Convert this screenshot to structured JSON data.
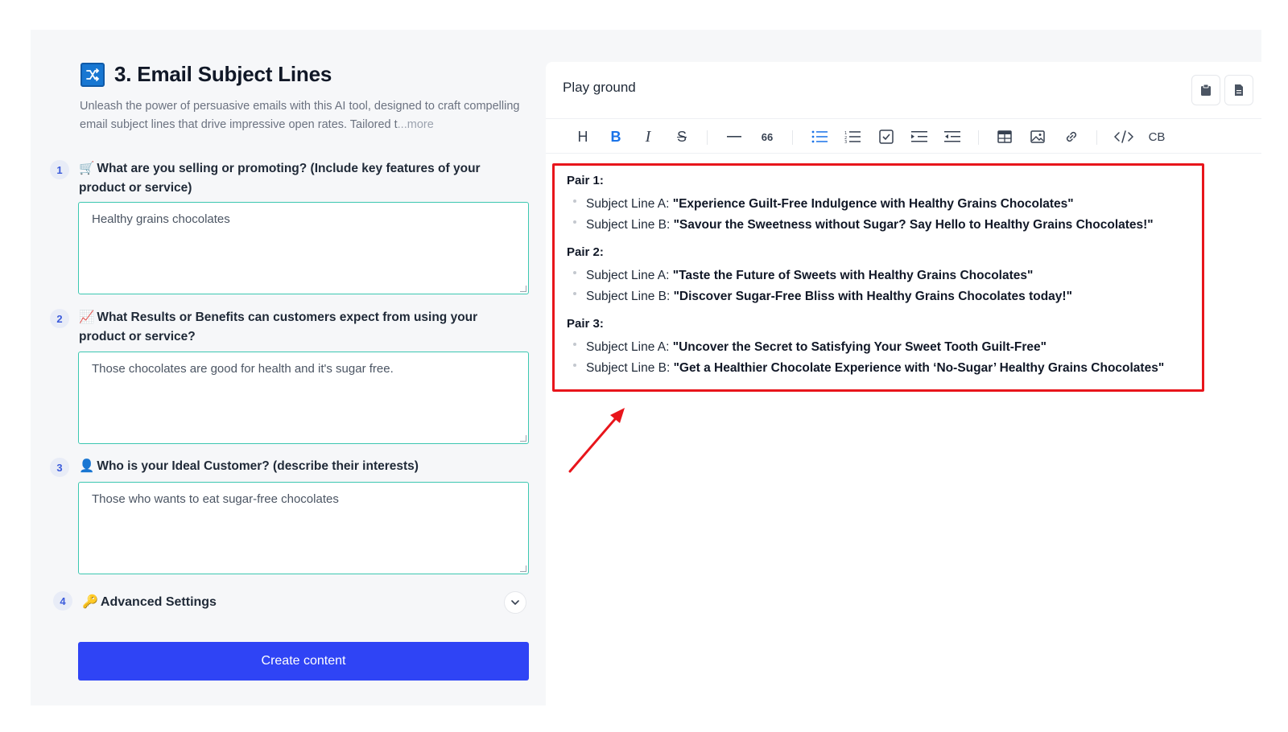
{
  "left": {
    "title": "3. Email Subject Lines",
    "description": "Unleash the power of persuasive emails with this AI tool, designed to craft compelling email subject lines that drive impressive open rates. Tailored t",
    "more_label": "...more",
    "questions": [
      {
        "number": "1",
        "emoji": "🛒",
        "label": "What are you selling or promoting? (Include key features of your product or service)",
        "value": "Healthy grains chocolates"
      },
      {
        "number": "2",
        "emoji": "📈",
        "label": "What Results or Benefits can customers expect from using your product or service?",
        "value": "Those chocolates are good for health and it's sugar free."
      },
      {
        "number": "3",
        "emoji": "👤",
        "label": "Who is your Ideal Customer? (describe their interests)",
        "value": "Those who wants to eat sugar-free chocolates"
      }
    ],
    "advanced": {
      "number": "4",
      "emoji": "🔑",
      "label": "Advanced Settings"
    },
    "create_button": "Create content"
  },
  "right": {
    "title": "Play ground",
    "toolbar": {
      "heading": "H",
      "bold": "B",
      "italic": "I",
      "strike": "S",
      "quote": "66",
      "codeblock": "CB"
    },
    "pairs": [
      {
        "title": "Pair 1:",
        "lines": [
          {
            "label": "Subject Line A: ",
            "value": "\"Experience Guilt-Free Indulgence with Healthy Grains Chocolates\""
          },
          {
            "label": "Subject Line B: ",
            "value": "\"Savour the Sweetness without Sugar? Say Hello to Healthy Grains Chocolates!\""
          }
        ]
      },
      {
        "title": "Pair 2:",
        "lines": [
          {
            "label": "Subject Line A: ",
            "value": "\"Taste the Future of Sweets with Healthy Grains Chocolates\""
          },
          {
            "label": "Subject Line B: ",
            "value": "\"Discover Sugar-Free Bliss with Healthy Grains Chocolates today!\""
          }
        ]
      },
      {
        "title": "Pair 3:",
        "lines": [
          {
            "label": "Subject Line A: ",
            "value": "\"Uncover the Secret to Satisfying Your Sweet Tooth Guilt-Free\""
          },
          {
            "label": "Subject Line B: ",
            "value": "\"Get a Healthier Chocolate Experience with ‘No-Sugar’ Healthy Grains Chocolates\""
          }
        ]
      }
    ]
  },
  "colors": {
    "accent": "#2f44f5",
    "input_border": "#3cc7b1",
    "highlight": "#e8151b",
    "active_tool": "#1a73e8"
  }
}
